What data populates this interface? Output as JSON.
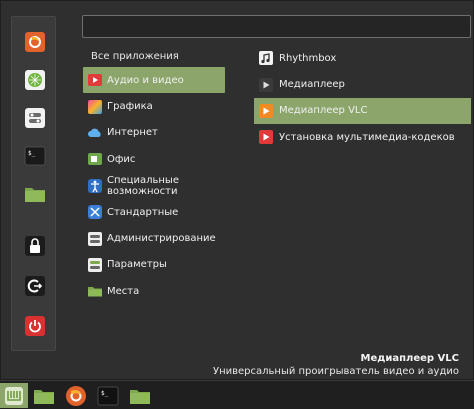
{
  "search": {
    "placeholder": "",
    "value": ""
  },
  "favorites": [
    {
      "icon": "firefox-icon",
      "name": "firefox"
    },
    {
      "icon": "software-manager-icon",
      "name": "software-manager"
    },
    {
      "icon": "settings-icon",
      "name": "system-settings"
    },
    {
      "icon": "terminal-icon",
      "name": "terminal"
    },
    {
      "icon": "folder-icon",
      "name": "files"
    },
    {
      "icon": "lock-icon",
      "name": "lock-screen"
    },
    {
      "icon": "logout-icon",
      "name": "logout"
    },
    {
      "icon": "power-icon",
      "name": "shutdown"
    }
  ],
  "categories": {
    "all_label": "Все приложения",
    "items": [
      {
        "label": "Аудио и видео",
        "icon": "audio-video-icon",
        "selected": true
      },
      {
        "label": "Графика",
        "icon": "graphics-icon"
      },
      {
        "label": "Интернет",
        "icon": "internet-icon"
      },
      {
        "label": "Офис",
        "icon": "office-icon"
      },
      {
        "label": "Специальные возможности",
        "icon": "accessibility-icon"
      },
      {
        "label": "Стандартные",
        "icon": "accessories-icon"
      },
      {
        "label": "Администрирование",
        "icon": "administration-icon"
      },
      {
        "label": "Параметры",
        "icon": "preferences-icon"
      },
      {
        "label": "Места",
        "icon": "places-icon"
      }
    ]
  },
  "apps": [
    {
      "label": "Rhythmbox",
      "icon": "rhythmbox-icon"
    },
    {
      "label": "Медиаплеер",
      "icon": "media-player-icon"
    },
    {
      "label": "Медиаплеер VLC",
      "icon": "vlc-icon",
      "selected": true
    },
    {
      "label": "Установка мультимедиа-кодеков",
      "icon": "codecs-icon"
    }
  ],
  "description": {
    "name": "Медиаплеер VLC",
    "text": "Универсальный проигрыватель видео и аудио"
  },
  "taskbar": [
    {
      "icon": "mint-menu-icon",
      "active": true
    },
    {
      "icon": "folder-icon"
    },
    {
      "icon": "firefox-icon"
    },
    {
      "icon": "terminal-icon"
    },
    {
      "icon": "folder-icon"
    }
  ],
  "colors": {
    "accent": "#8ba56b",
    "background": "#2f2f2f",
    "panel": "#3a3a3a"
  }
}
